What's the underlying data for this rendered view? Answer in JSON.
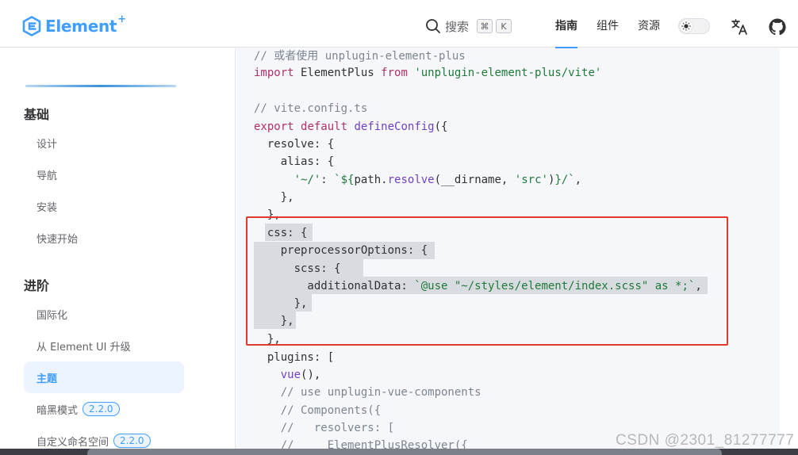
{
  "header": {
    "logo_text": "Element",
    "logo_sup": "+",
    "search_label": "搜索",
    "shortcut_keys": [
      "⌘",
      "K"
    ],
    "nav": [
      {
        "label": "指南",
        "active": true
      },
      {
        "label": "组件",
        "active": false
      },
      {
        "label": "资源",
        "active": false
      }
    ],
    "accent_color": "#409eff"
  },
  "sidebar": {
    "groups": [
      {
        "title": "基础",
        "items": [
          {
            "label": "设计"
          },
          {
            "label": "导航"
          },
          {
            "label": "安装"
          },
          {
            "label": "快速开始"
          }
        ]
      },
      {
        "title": "进阶",
        "items": [
          {
            "label": "国际化"
          },
          {
            "label": "从 Element UI 升级"
          },
          {
            "label": "主题",
            "active": true
          },
          {
            "label": "暗黑模式",
            "badge": "2.2.0"
          },
          {
            "label": "自定义命名空间",
            "badge": "2.2.0"
          }
        ]
      }
    ]
  },
  "code": {
    "lines": [
      "// 或者使用 unplugin-element-plus",
      "import ElementPlus from 'unplugin-element-plus/vite'",
      "",
      "// vite.config.ts",
      "export default defineConfig({",
      "  resolve: {",
      "    alias: {",
      "      '~/': `${path.resolve(__dirname, 'src')}/`,",
      "    },",
      "  },",
      "  css: {",
      "    preprocessorOptions: {",
      "      scss: {",
      "        additionalData: `@use \"~/styles/element/index.scss\" as *;`,",
      "      },",
      "    },",
      "  },",
      "  plugins: [",
      "    vue(),",
      "    // use unplugin-vue-components",
      "    // Components({",
      "    //   resolvers: [",
      "    //     ElementPlusResolver({"
    ]
  },
  "watermark": "CSDN @2301_81277777"
}
